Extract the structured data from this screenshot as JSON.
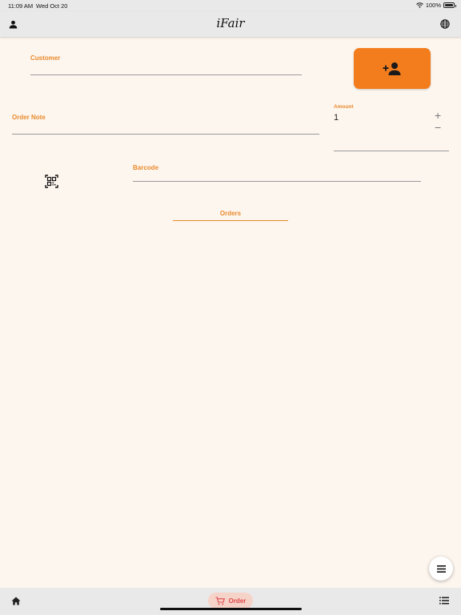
{
  "status_bar": {
    "time": "11:09 AM",
    "date": "Wed Oct 20",
    "battery": "100%"
  },
  "app_bar": {
    "title": "iFair",
    "left_icon": "person-icon",
    "right_icon": "globe-icon"
  },
  "form": {
    "customer_label": "Customer",
    "add_customer_icon": "person-add-icon",
    "order_note_label": "Order Note",
    "amount_label": "Amount",
    "amount_value": "1",
    "increment": "+",
    "decrement": "−",
    "qr_icon": "qr-scan-icon",
    "barcode_label": "Barcode"
  },
  "tabs": {
    "orders": "Orders"
  },
  "fab_icon": "menu-icon",
  "bottom_nav": {
    "home_icon": "home-icon",
    "order_icon": "cart-icon",
    "order_label": "Order",
    "list_icon": "list-icon"
  },
  "colors": {
    "accent": "#e98a2c",
    "button": "#f37d1d",
    "nav_active": "#e0494d",
    "background": "#fdf6ef"
  }
}
